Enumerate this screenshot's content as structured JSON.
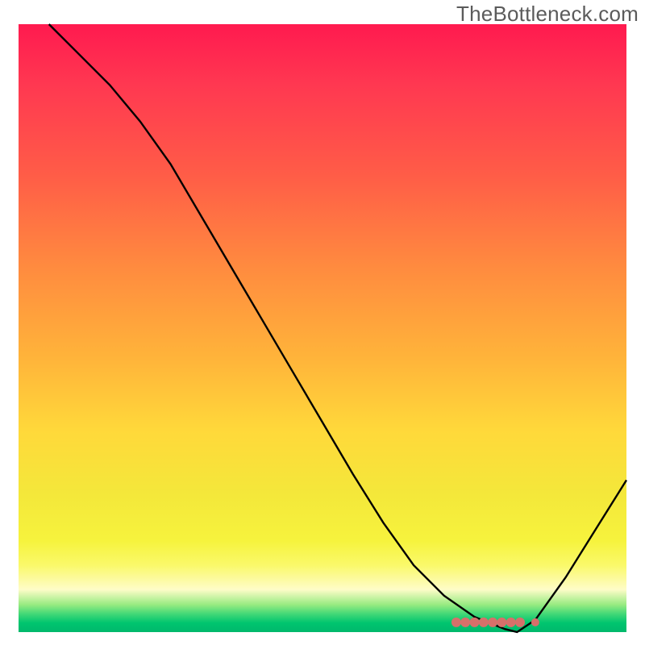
{
  "watermark": "TheBottleneck.com",
  "colors": {
    "gradient_top": "#ff1a4f",
    "gradient_mid": "#ffd93a",
    "gradient_bottom": "#00b86c",
    "curve": "#000000",
    "dots": "#d6706a"
  },
  "chart_data": {
    "type": "line",
    "title": "",
    "xlabel": "",
    "ylabel": "",
    "x_range": [
      0,
      100
    ],
    "y_range": [
      0,
      100
    ],
    "series": [
      {
        "name": "curve",
        "x": [
          5,
          10,
          15,
          20,
          25,
          30,
          35,
          40,
          45,
          50,
          55,
          60,
          65,
          70,
          75,
          80,
          82,
          85,
          90,
          95,
          100
        ],
        "y": [
          100,
          95,
          90,
          84,
          77,
          68.5,
          60,
          51.5,
          43,
          34.5,
          26,
          18,
          11,
          6,
          2.5,
          0.5,
          0,
          2,
          9,
          17,
          25
        ]
      }
    ],
    "annotations": {
      "dots_x": [
        72,
        73.5,
        75,
        76.5,
        78,
        79.5,
        81,
        82.5,
        85
      ],
      "dots_y": [
        1.6,
        1.6,
        1.6,
        1.6,
        1.6,
        1.6,
        1.6,
        1.6,
        1.6
      ]
    }
  }
}
